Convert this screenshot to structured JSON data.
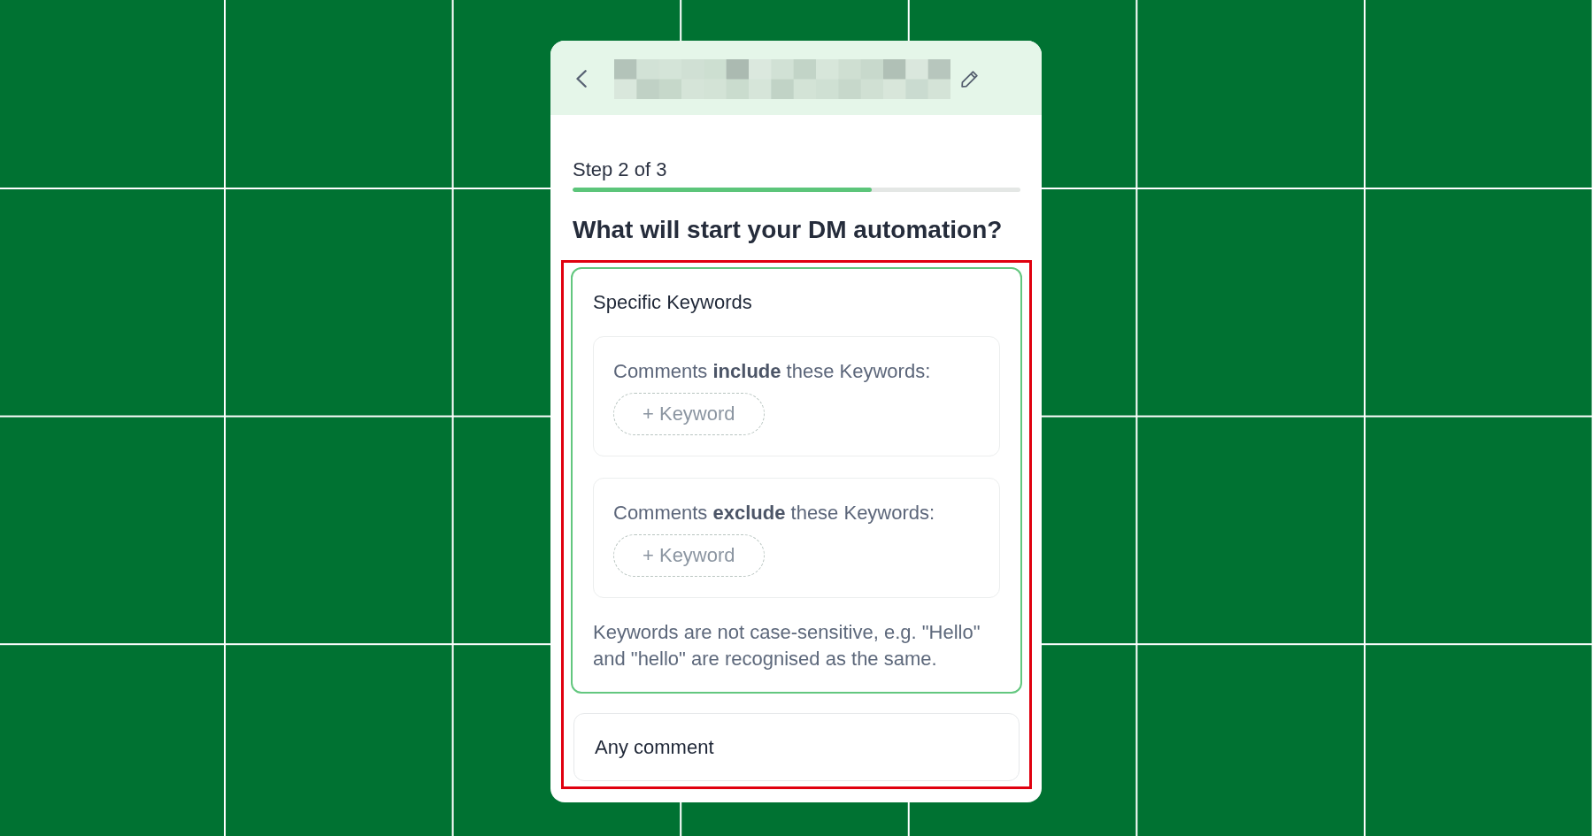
{
  "progress": {
    "label": "Step 2 of 3",
    "level": 0.667
  },
  "heading": "What will start your DM automation?",
  "options": [
    {
      "title": "Specific Keywords",
      "selected": true,
      "keyword_groups": [
        {
          "label": "Comments **include** these Keywords:",
          "button": "+ Keyword"
        },
        {
          "label": "Comments **exclude** these Keywords:",
          "button": "+ Keyword"
        }
      ],
      "note": "Keywords are not case-sensitive, e.g. \"Hello\" and \"hello\" are recognised as the same."
    },
    {
      "title": "Any comment",
      "selected": false
    }
  ]
}
